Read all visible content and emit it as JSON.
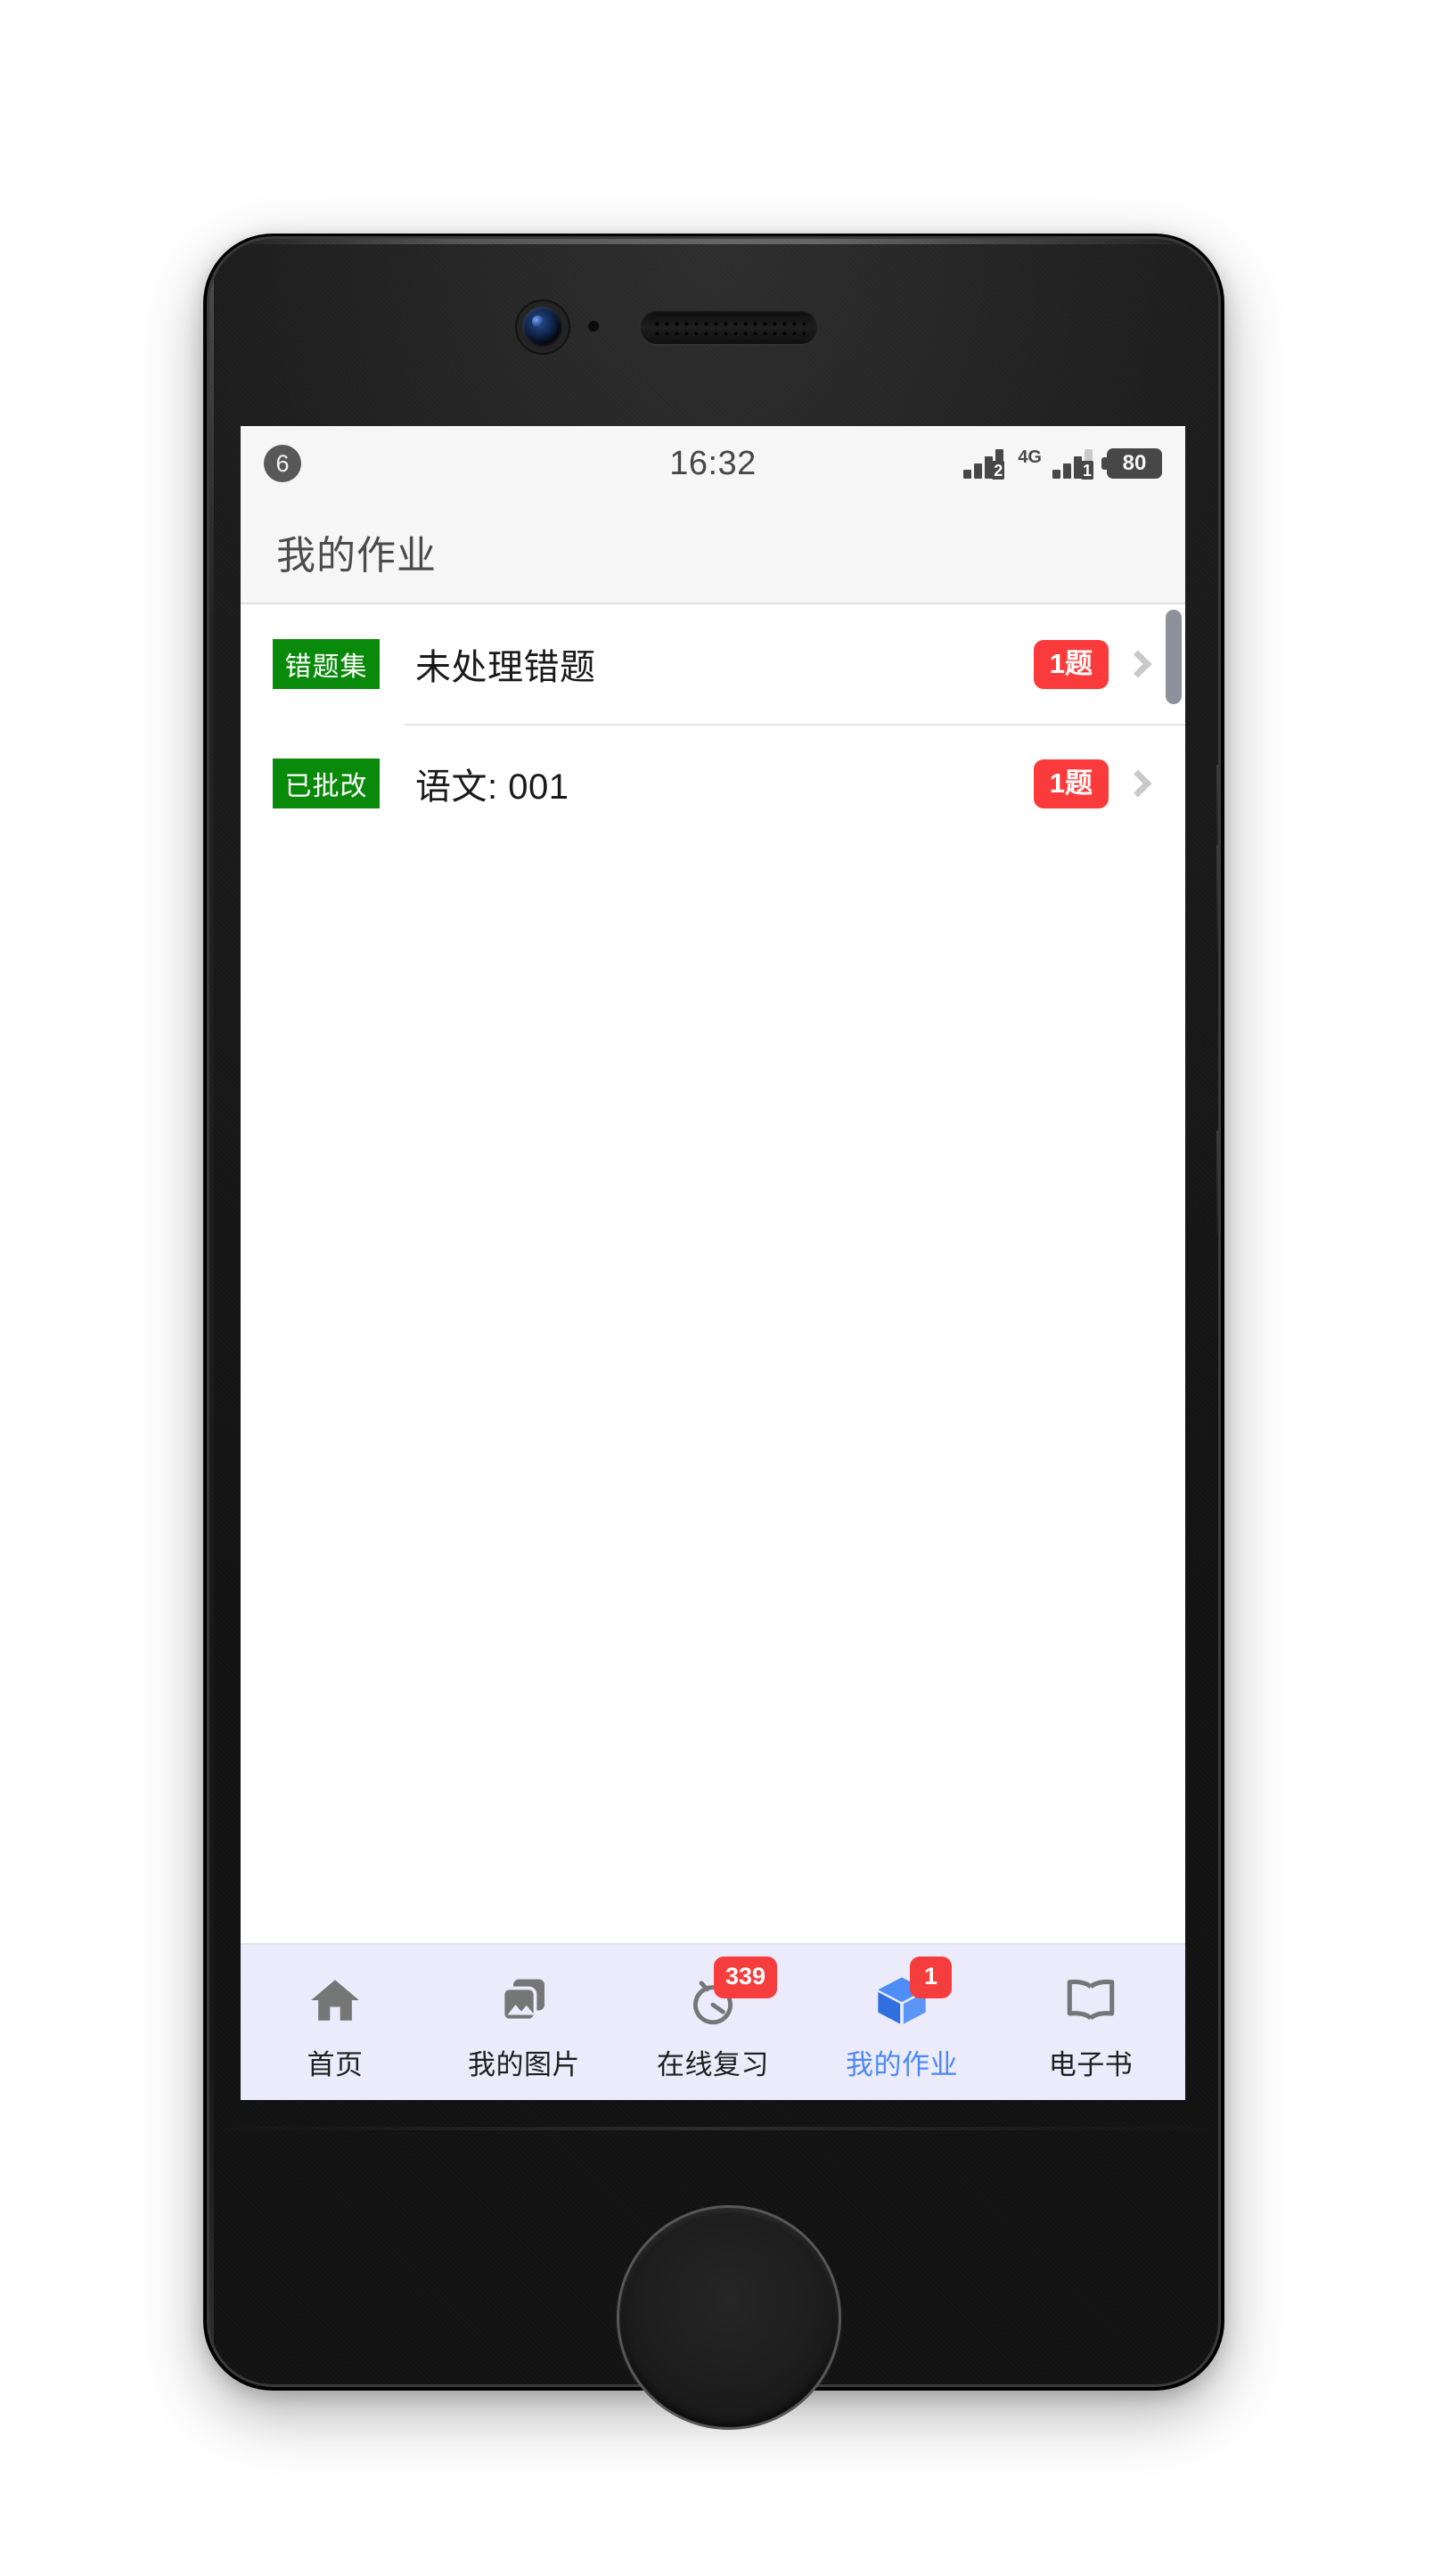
{
  "status_bar": {
    "notification_count": "6",
    "time": "16:32",
    "sim1_label": "2",
    "network_type": "4G",
    "sim2_label": "1",
    "battery_level": "80"
  },
  "header": {
    "title": "我的作业"
  },
  "list": {
    "rows": [
      {
        "tag": "错题集",
        "title": "未处理错题",
        "count": "1题",
        "chevron": "chevron-right-icon"
      },
      {
        "tag": "已批改",
        "title": "语文: 001",
        "count": "1题",
        "chevron": "chevron-right-icon"
      }
    ]
  },
  "tab_bar": {
    "items": [
      {
        "label": "首页",
        "icon": "home-icon",
        "badge": "",
        "active": false
      },
      {
        "label": "我的图片",
        "icon": "photos-icon",
        "badge": "",
        "active": false
      },
      {
        "label": "在线复习",
        "icon": "timer-icon",
        "badge": "339",
        "active": false
      },
      {
        "label": "我的作业",
        "icon": "cube-icon",
        "badge": "1",
        "active": true
      },
      {
        "label": "电子书",
        "icon": "book-icon",
        "badge": "",
        "active": false
      }
    ]
  },
  "colors": {
    "tag_green": "#0a8a0a",
    "badge_red": "#fb3b3b",
    "active_blue": "#4b88f7",
    "tabbar_bg": "#ebebfb",
    "header_bg": "#f6f6f6"
  }
}
